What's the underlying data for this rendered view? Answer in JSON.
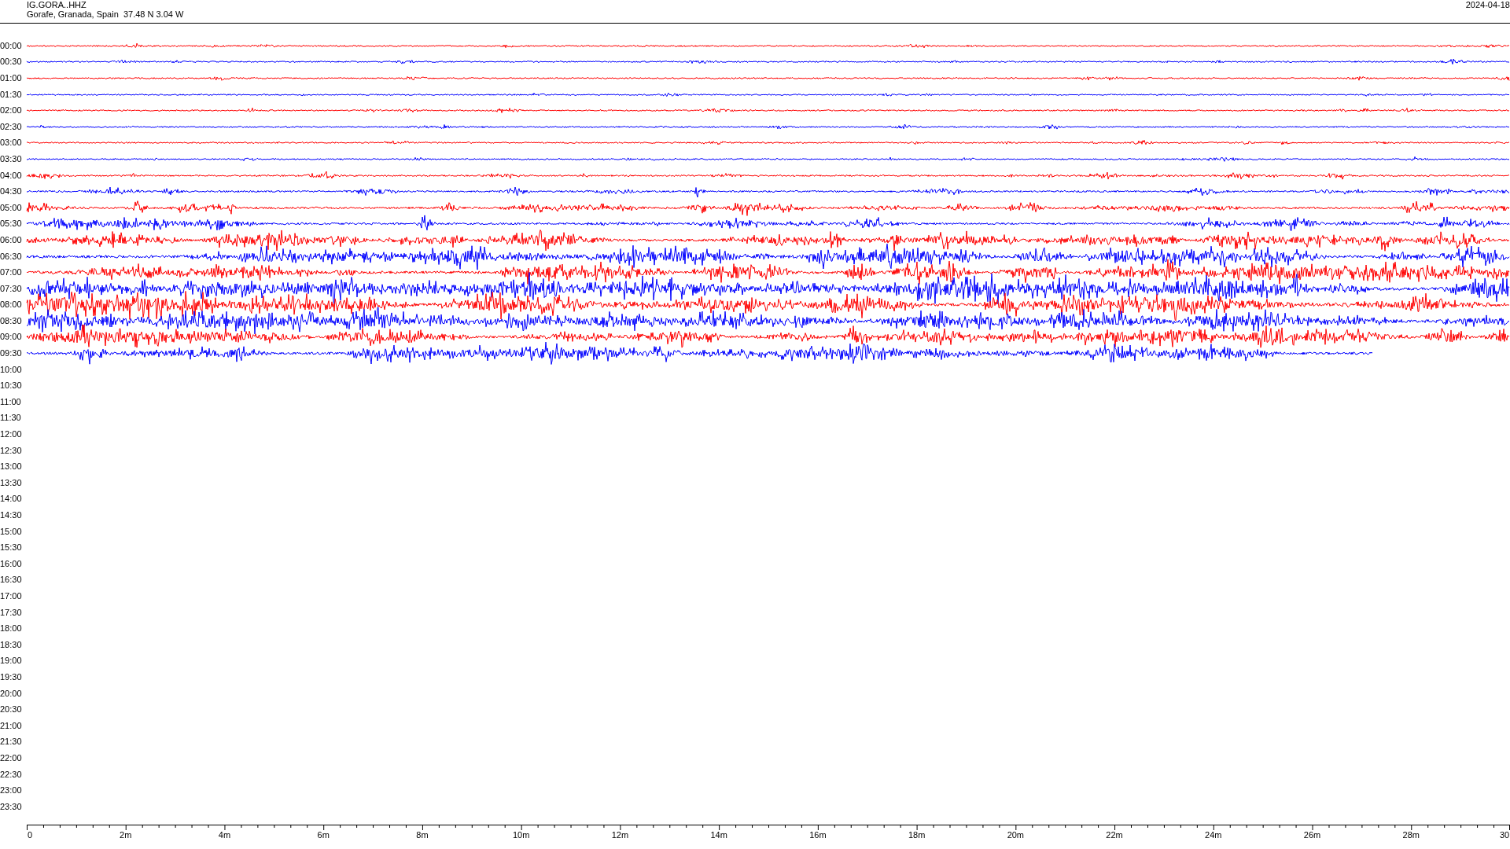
{
  "header": {
    "station": "IG.GORA..HHZ",
    "location": "Gorafe, Granada, Spain  37.48 N 3.04 W",
    "date": "2024-04-18"
  },
  "rows": [
    {
      "label": "00:00",
      "kind": "full",
      "color": "#ff0000"
    },
    {
      "label": "00:30",
      "kind": "full",
      "color": "#0000ff"
    },
    {
      "label": "01:00",
      "kind": "full",
      "color": "#ff0000"
    },
    {
      "label": "01:30",
      "kind": "full",
      "color": "#0000ff"
    },
    {
      "label": "02:00",
      "kind": "full",
      "color": "#ff0000"
    },
    {
      "label": "02:30",
      "kind": "full",
      "color": "#0000ff"
    },
    {
      "label": "03:00",
      "kind": "full",
      "color": "#ff0000"
    },
    {
      "label": "03:30",
      "kind": "full",
      "color": "#0000ff"
    },
    {
      "label": "04:00",
      "kind": "full",
      "color": "#ff0000"
    },
    {
      "label": "04:30",
      "kind": "full",
      "color": "#0000ff"
    },
    {
      "label": "05:00",
      "kind": "full",
      "color": "#ff0000"
    },
    {
      "label": "05:30",
      "kind": "full",
      "color": "#0000ff"
    },
    {
      "label": "06:00",
      "kind": "full",
      "color": "#ff0000"
    },
    {
      "label": "06:30",
      "kind": "full",
      "color": "#0000ff"
    },
    {
      "label": "07:00",
      "kind": "full",
      "color": "#ff0000"
    },
    {
      "label": "07:30",
      "kind": "full",
      "color": "#0000ff"
    },
    {
      "label": "08:00",
      "kind": "full",
      "color": "#ff0000"
    },
    {
      "label": "08:30",
      "kind": "full",
      "color": "#0000ff"
    },
    {
      "label": "09:00",
      "kind": "full",
      "color": "#ff0000"
    },
    {
      "label": "09:30",
      "kind": "partial",
      "color": "#0000ff"
    },
    {
      "label": "10:00",
      "kind": "empty"
    },
    {
      "label": "10:30",
      "kind": "empty"
    },
    {
      "label": "11:00",
      "kind": "empty"
    },
    {
      "label": "11:30",
      "kind": "empty"
    },
    {
      "label": "12:00",
      "kind": "empty"
    },
    {
      "label": "12:30",
      "kind": "empty"
    },
    {
      "label": "13:00",
      "kind": "empty"
    },
    {
      "label": "13:30",
      "kind": "empty"
    },
    {
      "label": "14:00",
      "kind": "empty"
    },
    {
      "label": "14:30",
      "kind": "empty"
    },
    {
      "label": "15:00",
      "kind": "empty"
    },
    {
      "label": "15:30",
      "kind": "empty"
    },
    {
      "label": "16:00",
      "kind": "empty"
    },
    {
      "label": "16:30",
      "kind": "empty"
    },
    {
      "label": "17:00",
      "kind": "empty"
    },
    {
      "label": "17:30",
      "kind": "empty"
    },
    {
      "label": "18:00",
      "kind": "empty"
    },
    {
      "label": "18:30",
      "kind": "empty"
    },
    {
      "label": "19:00",
      "kind": "empty"
    },
    {
      "label": "19:30",
      "kind": "empty"
    },
    {
      "label": "20:00",
      "kind": "empty"
    },
    {
      "label": "20:30",
      "kind": "empty"
    },
    {
      "label": "21:00",
      "kind": "empty"
    },
    {
      "label": "21:30",
      "kind": "empty"
    },
    {
      "label": "22:00",
      "kind": "empty"
    },
    {
      "label": "22:30",
      "kind": "empty"
    },
    {
      "label": "23:00",
      "kind": "empty"
    },
    {
      "label": "23:30",
      "kind": "empty"
    }
  ],
  "time_axis": {
    "labels": [
      "0",
      "2m",
      "4m",
      "6m",
      "8m",
      "10m",
      "12m",
      "14m",
      "16m",
      "18m",
      "20m",
      "22m",
      "24m",
      "26m",
      "28m",
      "30"
    ]
  }
}
